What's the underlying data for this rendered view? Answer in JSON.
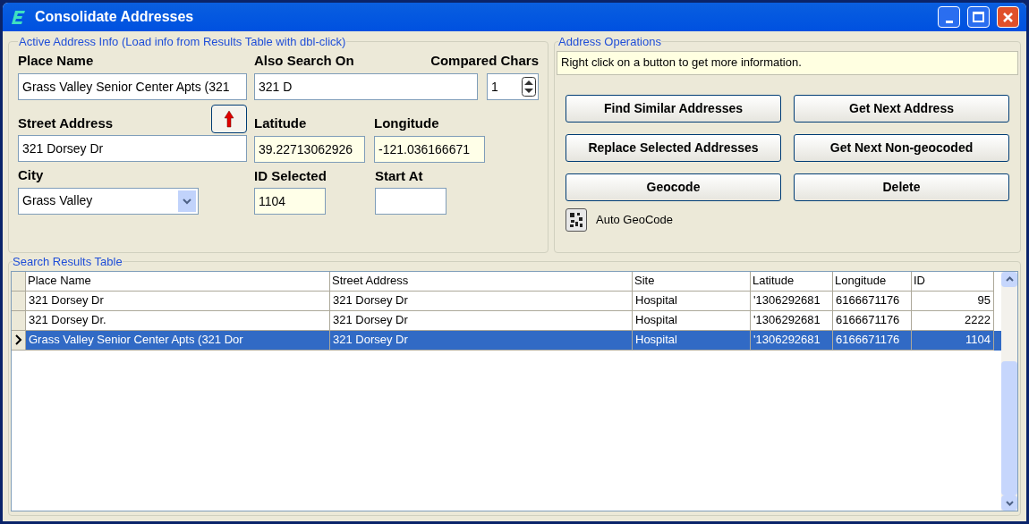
{
  "window": {
    "title": "Consolidate Addresses"
  },
  "active_address": {
    "legend": "Active Address Info (Load info from Results Table with dbl-click)",
    "place_name": {
      "label": "Place Name",
      "value": "Grass Valley Senior Center Apts (321"
    },
    "also_search_on": {
      "label": "Also Search On",
      "value": "321 D"
    },
    "compared_chars": {
      "label": "Compared Chars",
      "value": "1"
    },
    "street_address": {
      "label": "Street Address",
      "value": "321 Dorsey Dr"
    },
    "latitude": {
      "label": "Latitude",
      "value": "39.22713062926"
    },
    "longitude": {
      "label": "Longitude",
      "value": "-121.036166671"
    },
    "city": {
      "label": "City",
      "value": "Grass Valley"
    },
    "id_selected": {
      "label": "ID Selected",
      "value": "1104"
    },
    "start_at": {
      "label": "Start At"
    }
  },
  "address_operations": {
    "legend": "Address Operations",
    "info": "Right click on a button to get more information.",
    "buttons": [
      "Find Similar Addresses",
      "Get Next Address",
      "Replace Selected Addresses",
      "Get Next Non-geocoded",
      "Geocode",
      "Delete"
    ],
    "auto_geocode": {
      "label": "Auto GeoCode"
    }
  },
  "results": {
    "legend": "Search Results Table",
    "columns": [
      "Place Name",
      "Street Address",
      "Site",
      "Latitude",
      "Longitude",
      "ID"
    ],
    "rows": [
      {
        "cells": [
          "321 Dorsey Dr",
          "321 Dorsey Dr",
          "Hospital",
          "'1306292681",
          "6166671176",
          "95"
        ],
        "selected": false
      },
      {
        "cells": [
          "321 Dorsey Dr.",
          "321 Dorsey Dr",
          "Hospital",
          "'1306292681",
          "6166671176",
          "2222"
        ],
        "selected": false
      },
      {
        "cells": [
          "Grass Valley Senior Center Apts (321 Dor",
          "321 Dorsey Dr",
          "Hospital",
          "'1306292681",
          "6166671176",
          "1104"
        ],
        "selected": true
      }
    ]
  }
}
